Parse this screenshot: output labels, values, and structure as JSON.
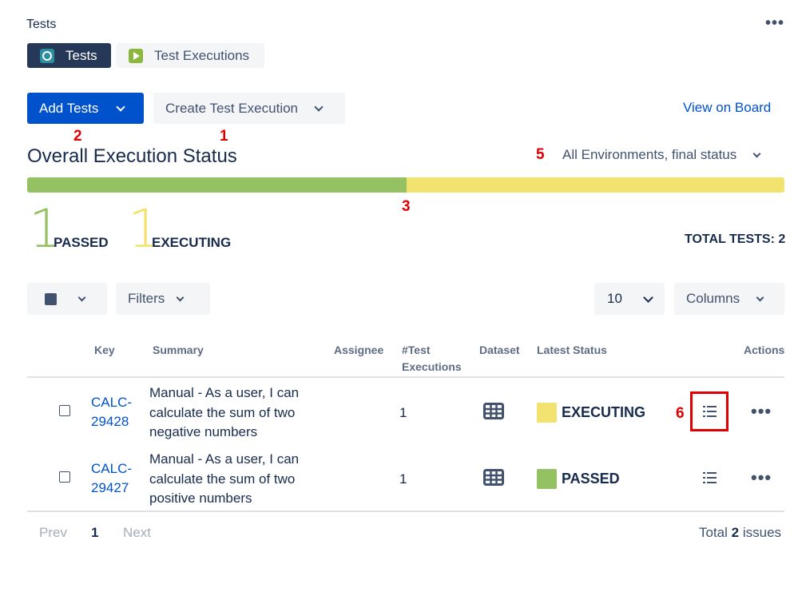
{
  "section": {
    "title": "Tests"
  },
  "tabs": [
    {
      "label": "Tests",
      "active": true,
      "icon": "tests-icon"
    },
    {
      "label": "Test Executions",
      "active": false,
      "icon": "test-executions-icon"
    }
  ],
  "toolbar": {
    "add_tests_label": "Add Tests",
    "create_execution_label": "Create Test Execution",
    "view_on_board_label": "View on Board"
  },
  "annotations": {
    "a1": "1",
    "a2": "2",
    "a3": "3",
    "a5": "5",
    "a6": "6"
  },
  "overall": {
    "heading": "Overall Execution Status",
    "environment": "All Environments, final status",
    "progress": {
      "passed_fraction": 0.5,
      "executing_fraction": 0.5
    },
    "passed_count": "1",
    "passed_label": "PASSED",
    "executing_count": "1",
    "executing_label": "EXECUTING",
    "total_tests": "TOTAL TESTS: 2"
  },
  "controls": {
    "filters_label": "Filters",
    "page_size": "10",
    "columns_label": "Columns"
  },
  "table": {
    "headers": {
      "key": "Key",
      "summary": "Summary",
      "assignee": "Assignee",
      "test_exec_1": "#Test",
      "test_exec_2": "Executions",
      "dataset": "Dataset",
      "latest_status": "Latest Status",
      "actions": "Actions"
    },
    "rows": [
      {
        "key_1": "CALC-",
        "key_2": "29428",
        "summary_1": "Manual - As a user, I can",
        "summary_2": "calculate the sum of two",
        "summary_3": "negative numbers",
        "executions": "1",
        "status": "EXECUTING",
        "status_color": "#f2e26f"
      },
      {
        "key_1": "CALC-",
        "key_2": "29427",
        "summary_1": "Manual - As a user, I can",
        "summary_2": "calculate the sum of two",
        "summary_3": "positive numbers",
        "executions": "1",
        "status": "PASSED",
        "status_color": "#94c262"
      }
    ]
  },
  "pagination": {
    "prev": "Prev",
    "current": "1",
    "next": "Next",
    "total_prefix": "Total",
    "total_count": "2",
    "total_suffix": "issues"
  },
  "colors": {
    "passed": "#94c262",
    "executing": "#f2e26f",
    "primary": "#0052cc",
    "annotation": "#e00000"
  }
}
